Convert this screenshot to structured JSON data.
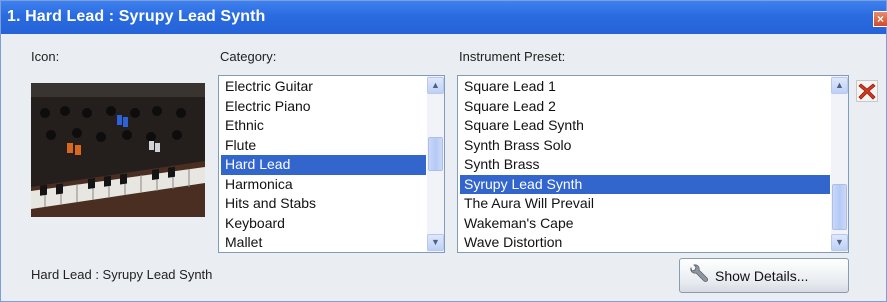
{
  "window": {
    "title": "1. Hard Lead : Syrupy Lead Synth",
    "close_glyph": "×"
  },
  "labels": {
    "icon": "Icon:",
    "category": "Category:",
    "preset": "Instrument Preset:"
  },
  "category": {
    "items": [
      "Electric Guitar",
      "Electric Piano",
      "Ethnic",
      "Flute",
      "Hard Lead",
      "Harmonica",
      "Hits and Stabs",
      "Keyboard",
      "Mallet"
    ],
    "selected_index": 4
  },
  "preset": {
    "items": [
      "Square Lead 1",
      "Square Lead 2",
      "Square Lead Synth",
      "Synth Brass Solo",
      "Synth Brass",
      "Syrupy Lead Synth",
      "The Aura Will Prevail",
      "Wakeman's Cape",
      "Wave Distortion"
    ],
    "selected_index": 5
  },
  "status_text": "Hard Lead : Syrupy Lead Synth",
  "buttons": {
    "show_details": "Show Details..."
  },
  "colors": {
    "selection": "#3366cc",
    "titlebar": "#2a6be0",
    "delete_red": "#d43a1e"
  },
  "icons": {
    "delete": "delete-icon",
    "details": "wrench-icon",
    "scroll_up": "chevron-up-icon",
    "scroll_down": "chevron-down-icon"
  }
}
